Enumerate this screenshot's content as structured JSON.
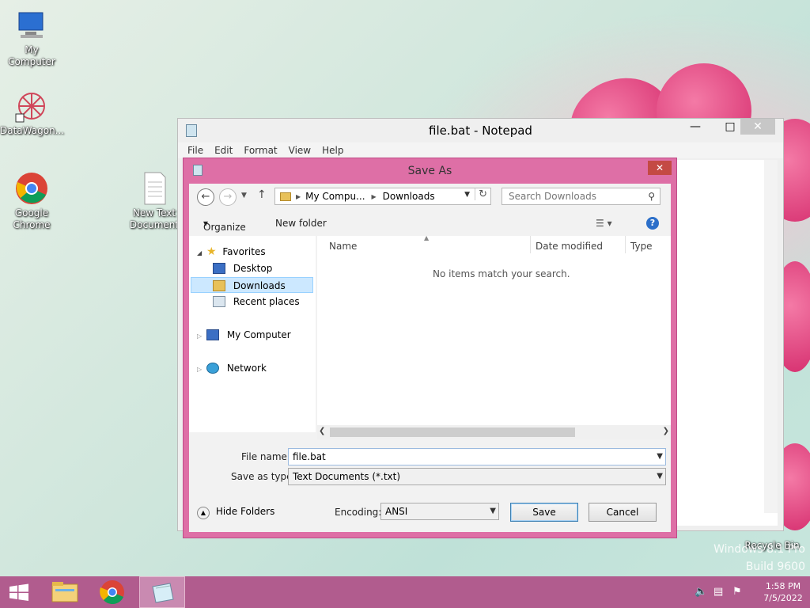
{
  "desktop": {
    "icons": [
      {
        "label": "My Computer"
      },
      {
        "label": "DataWagon..."
      },
      {
        "label": "Google Chrome"
      },
      {
        "label": "New Text Document"
      },
      {
        "label": "Recycle Bin"
      }
    ],
    "watermark": {
      "line1": "Windows 8.1 Pro",
      "line2": "Build 9600"
    }
  },
  "notepad": {
    "title": "file.bat - Notepad",
    "menu": [
      "File",
      "Edit",
      "Format",
      "View",
      "Help"
    ]
  },
  "dialog": {
    "title": "Save As",
    "close_label": "✕",
    "address": {
      "crumbs": [
        "My Compu...",
        "Downloads"
      ]
    },
    "search_placeholder": "Search Downloads",
    "toolbar": {
      "organize": "Organize",
      "new_folder": "New folder"
    },
    "nav": {
      "favorites": "Favorites",
      "desktop": "Desktop",
      "downloads": "Downloads",
      "recent": "Recent places",
      "my_computer": "My Computer",
      "network": "Network"
    },
    "columns": {
      "name": "Name",
      "date": "Date modified",
      "type": "Type"
    },
    "empty_message": "No items match your search.",
    "file_name_label": "File name:",
    "file_name_value": "file.bat",
    "save_type_label": "Save as type:",
    "save_type_value": "Text Documents (*.txt)",
    "hide_folders": "Hide Folders",
    "encoding_label": "Encoding:",
    "encoding_value": "ANSI",
    "save_button": "Save",
    "cancel_button": "Cancel"
  },
  "taskbar": {
    "time": "1:58 PM",
    "date": "7/5/2022"
  },
  "colors": {
    "dialog_frame": "#de6fa6",
    "taskbar": "#b15c8e",
    "selection": "#cce8ff"
  }
}
